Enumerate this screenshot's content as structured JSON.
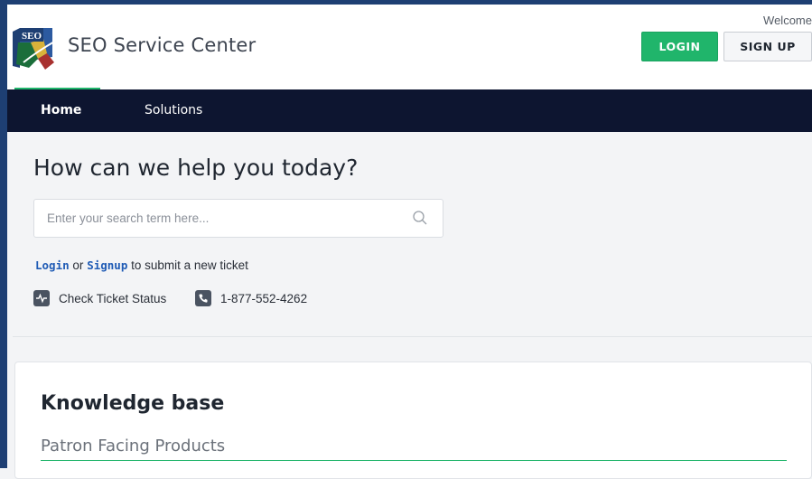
{
  "header": {
    "brand": "SEO Service Center",
    "logo_text": "SEO",
    "welcome": "Welcome",
    "login_label": "LOGIN",
    "signup_label": "SIGN UP"
  },
  "nav": {
    "items": [
      {
        "label": "Home",
        "active": true
      },
      {
        "label": "Solutions",
        "active": false
      }
    ]
  },
  "hero": {
    "title": "How can we help you today?",
    "search_placeholder": "Enter your search term here...",
    "search_icon": "search-icon",
    "login_link": "Login",
    "or_text": "or",
    "signup_link": "Signup",
    "submit_text": "to submit a new ticket",
    "check_status": "Check Ticket Status",
    "check_status_icon": "activity-icon",
    "phone": "1-877-552-4262",
    "phone_icon": "phone-icon"
  },
  "knowledge_base": {
    "title": "Knowledge base",
    "category": "Patron Facing Products"
  },
  "colors": {
    "frame": "#1e3f73",
    "nav_bg": "#0d1530",
    "accent_green": "#20b56b",
    "link_blue": "#1f5bb5"
  }
}
